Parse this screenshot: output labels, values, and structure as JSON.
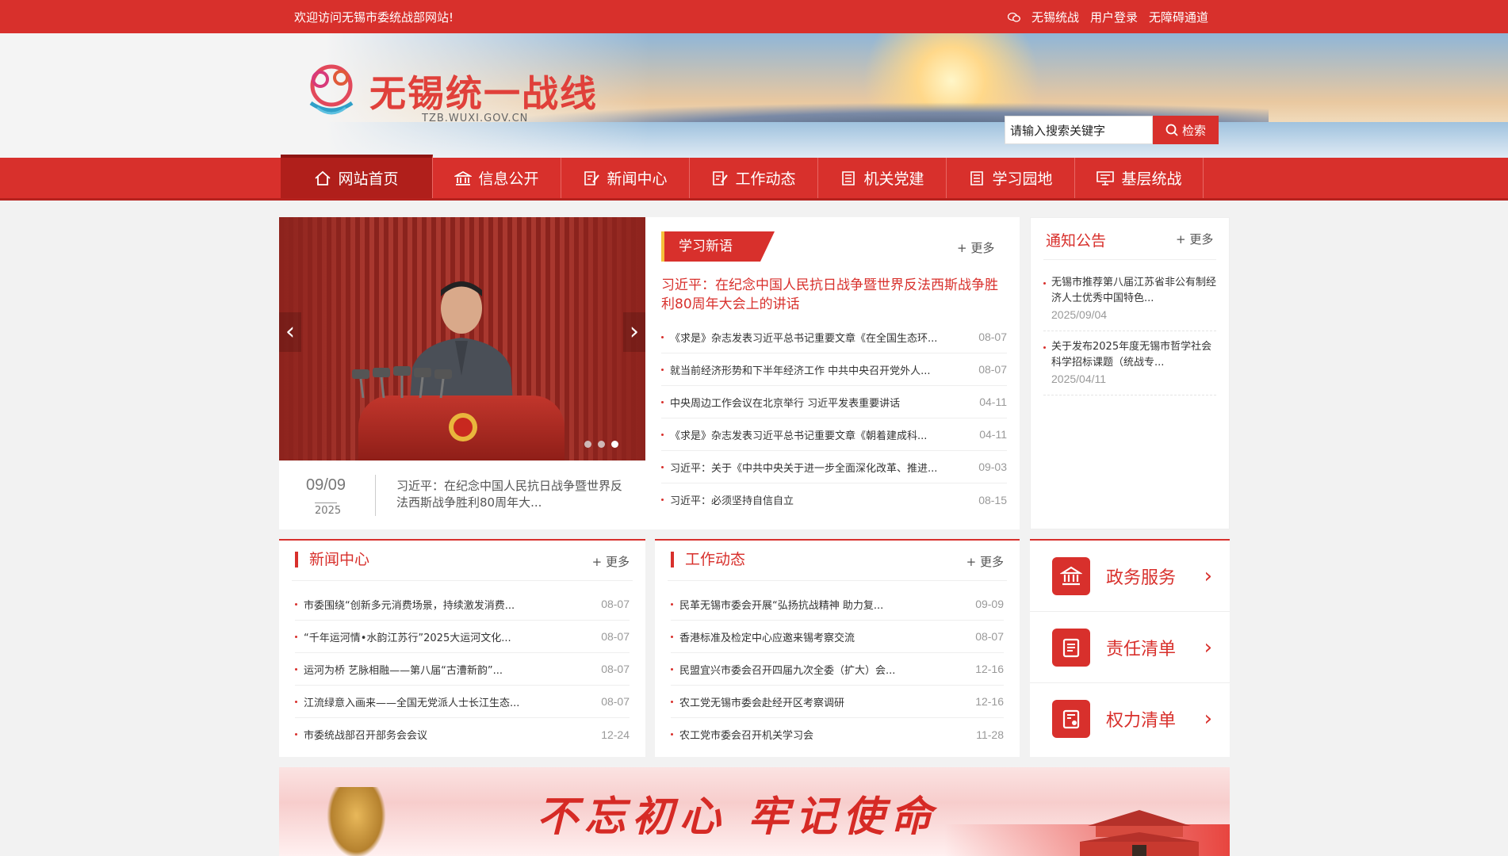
{
  "topbar": {
    "welcome": "欢迎访问无锡市委统战部网站!",
    "links": [
      "无锡统战",
      "用户登录",
      "无障碍通道"
    ]
  },
  "header": {
    "title": "无锡统一战线",
    "domain": "TZB.WUXI.GOV.CN",
    "search_value": "请输入搜索关键字",
    "search_button": "检索"
  },
  "nav": [
    {
      "label": "网站首页",
      "icon": "home-icon",
      "active": true
    },
    {
      "label": "信息公开",
      "icon": "building-icon"
    },
    {
      "label": "新闻中心",
      "icon": "edit-icon"
    },
    {
      "label": "工作动态",
      "icon": "edit-icon"
    },
    {
      "label": "机关党建",
      "icon": "document-icon"
    },
    {
      "label": "学习园地",
      "icon": "document-icon"
    },
    {
      "label": "基层统战",
      "icon": "monitor-icon"
    }
  ],
  "slider": {
    "date": "09/09",
    "year": "2025",
    "caption": "习近平：在纪念中国人民抗日战争暨世界反法西斯战争胜利80周年大..."
  },
  "study": {
    "title": "学习新语",
    "more": "+ 更多",
    "headline": "习近平：在纪念中国人民抗日战争暨世界反法西斯战争胜利80周年大会上的讲话",
    "items": [
      {
        "text": "《求是》杂志发表习近平总书记重要文章《在全国生态环...",
        "date": "08-07"
      },
      {
        "text": "就当前经济形势和下半年经济工作 中共中央召开党外人...",
        "date": "08-07"
      },
      {
        "text": "中央周边工作会议在北京举行 习近平发表重要讲话",
        "date": "04-11"
      },
      {
        "text": "《求是》杂志发表习近平总书记重要文章《朝着建成科...",
        "date": "04-11"
      },
      {
        "text": "习近平：关于《中共中央关于进一步全面深化改革、推进...",
        "date": "09-03"
      },
      {
        "text": "习近平：必须坚持自信自立",
        "date": "08-15"
      }
    ]
  },
  "notice": {
    "title": "通知公告",
    "more": "+ 更多",
    "items": [
      {
        "text": "无锡市推荐第八届江苏省非公有制经济人士优秀中国特色...",
        "date": "2025/09/04"
      },
      {
        "text": "关于发布2025年度无锡市哲学社会科学招标课题（统战专...",
        "date": "2025/04/11"
      }
    ]
  },
  "news": {
    "title": "新闻中心",
    "more": "+ 更多",
    "items": [
      {
        "text": "市委围绕“创新多元消费场景，持续激发消费...",
        "date": "08-07"
      },
      {
        "text": "“千年运河情•水韵江苏行”2025大运河文化...",
        "date": "08-07"
      },
      {
        "text": "运河为桥 艺脉相融——第八届“古漕新韵”...",
        "date": "08-07"
      },
      {
        "text": "江流绿意入画来——全国无党派人士长江生态...",
        "date": "08-07"
      },
      {
        "text": "市委统战部召开部务会会议",
        "date": "12-24"
      }
    ]
  },
  "work": {
    "title": "工作动态",
    "more": "+ 更多",
    "items": [
      {
        "text": "民革无锡市委会开展“弘扬抗战精神 助力复...",
        "date": "09-09"
      },
      {
        "text": "香港标准及检定中心应邀来锡考察交流",
        "date": "08-07"
      },
      {
        "text": "民盟宜兴市委会召开四届九次全委（扩大）会...",
        "date": "12-16"
      },
      {
        "text": "农工党无锡市委会赴经开区考察调研",
        "date": "12-16"
      },
      {
        "text": "农工党市委会召开机关学习会",
        "date": "11-28"
      }
    ]
  },
  "services": [
    {
      "label": "政务服务",
      "icon": "government-building-icon"
    },
    {
      "label": "责任清单",
      "icon": "clipboard-list-icon"
    },
    {
      "label": "权力清单",
      "icon": "badge-document-icon"
    }
  ],
  "bottom_banner": {
    "slogan": "不忘初心  牢记使命"
  },
  "colors": {
    "primary": "#d8302c",
    "dark": "#b01f1b",
    "accent": "#f5c23a"
  }
}
